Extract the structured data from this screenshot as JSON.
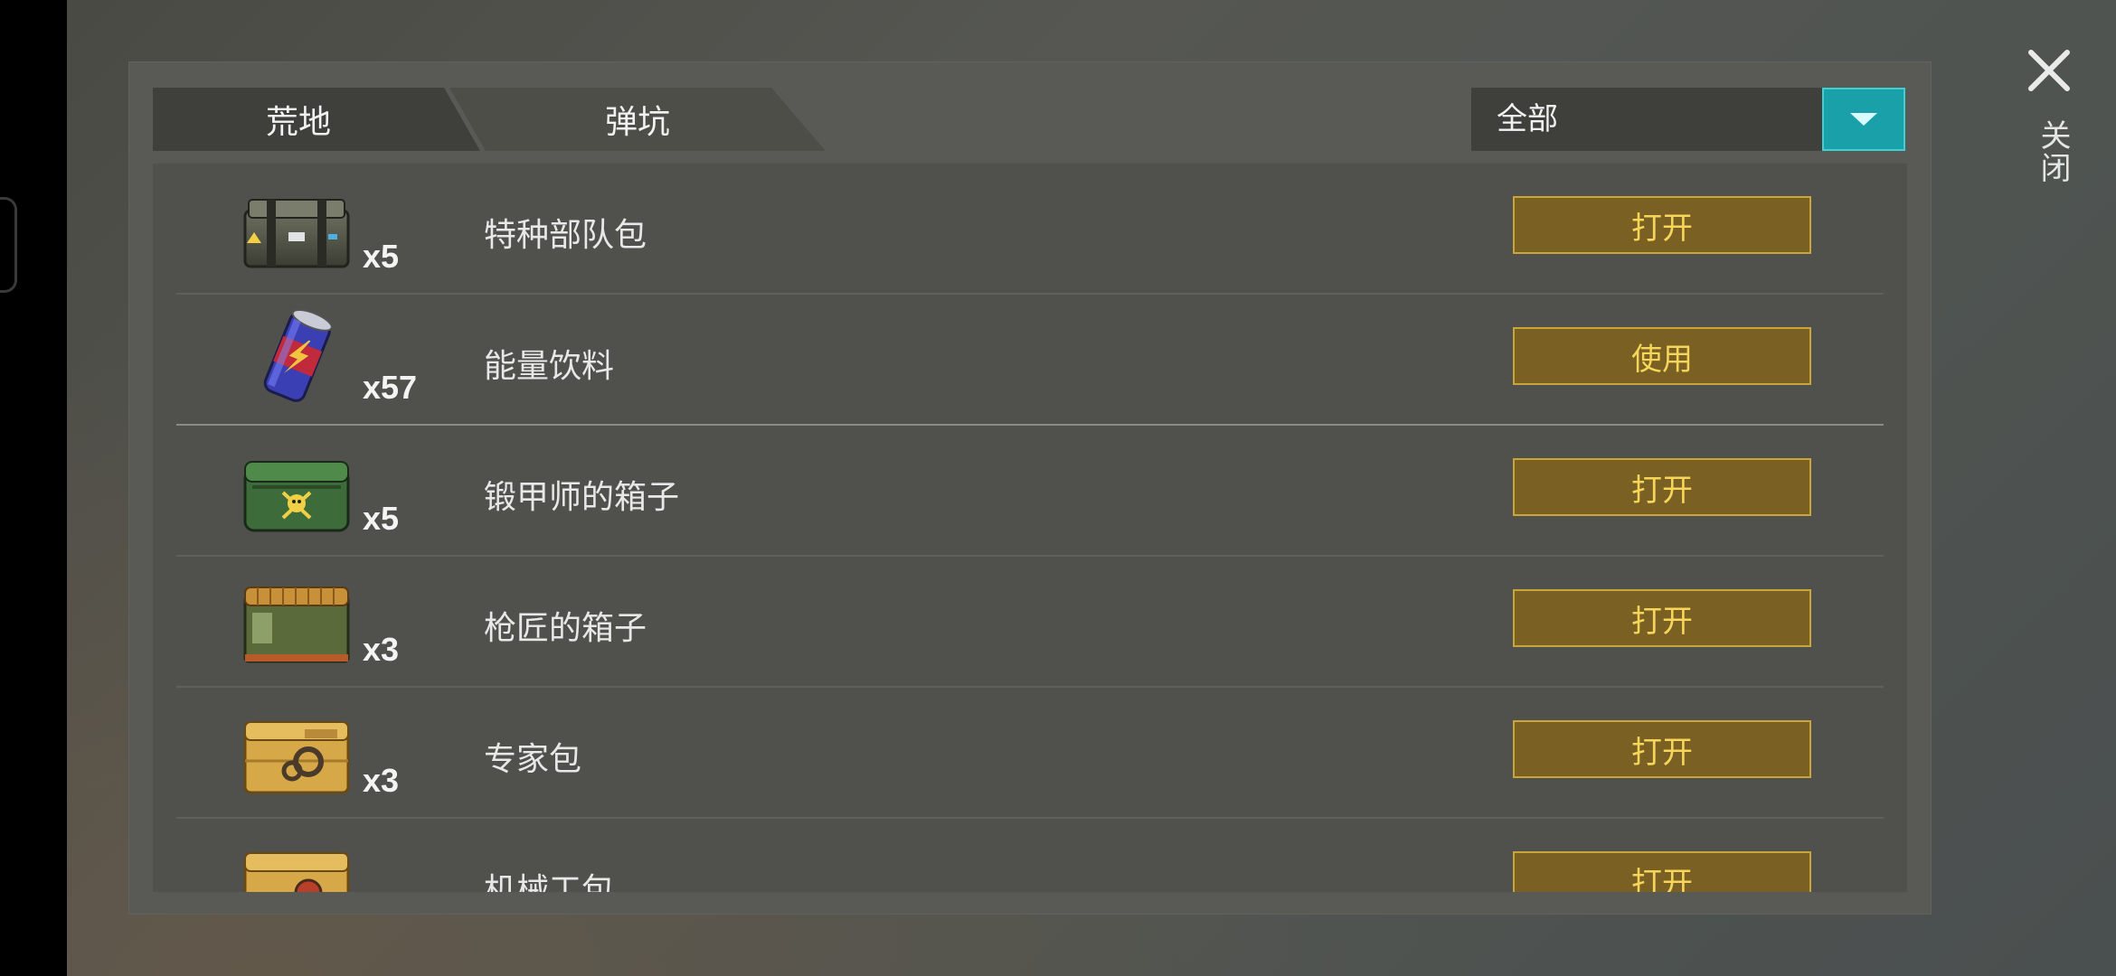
{
  "tabs": [
    {
      "label": "荒地"
    },
    {
      "label": "弹坑"
    }
  ],
  "filter": {
    "selected": "全部"
  },
  "close": {
    "label": "关闭"
  },
  "items": [
    {
      "name": "特种部队包",
      "qty": "x5",
      "action": "打开",
      "icon": "military-case-icon"
    },
    {
      "name": "能量饮料",
      "qty": "x57",
      "action": "使用",
      "icon": "energy-drink-icon"
    },
    {
      "name": "锻甲师的箱子",
      "qty": "x5",
      "action": "打开",
      "icon": "armorer-chest-icon"
    },
    {
      "name": "枪匠的箱子",
      "qty": "x3",
      "action": "打开",
      "icon": "gunsmith-crate-icon"
    },
    {
      "name": "专家包",
      "qty": "x3",
      "action": "打开",
      "icon": "expert-crate-icon"
    },
    {
      "name": "机械工包",
      "qty": "",
      "action": "打开",
      "icon": "mechanic-crate-icon"
    }
  ],
  "colors": {
    "accent_teal": "#1aa0a8",
    "button_fill": "#7a6123",
    "button_text": "#f5d55a"
  }
}
